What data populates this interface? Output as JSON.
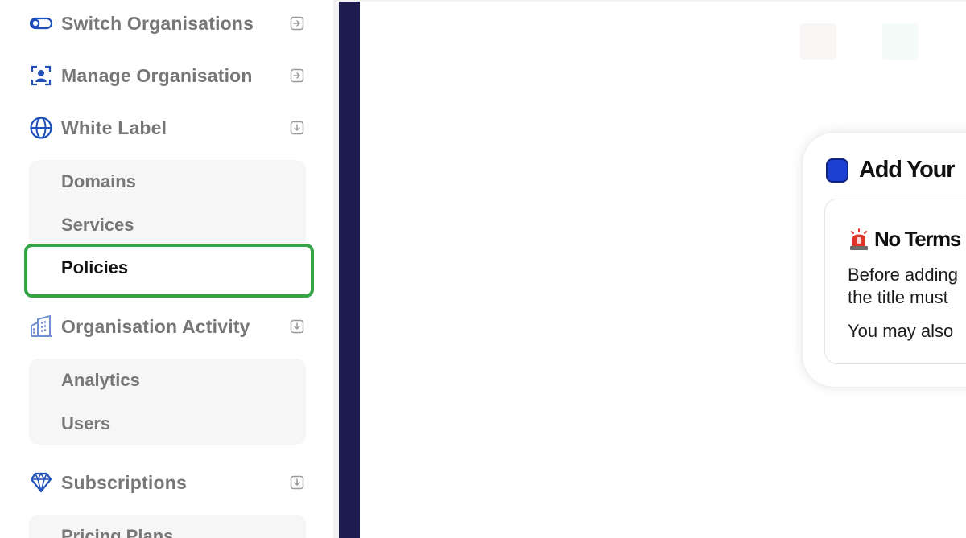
{
  "sidebar": {
    "items": [
      {
        "label": "Switch Organisations",
        "icon": "toggle-icon",
        "arrow": "arrow-right-icon"
      },
      {
        "label": "Manage Organisation",
        "icon": "user-frame-icon",
        "arrow": "arrow-right-icon"
      },
      {
        "label": "White Label",
        "icon": "globe-icon",
        "arrow": "arrow-down-icon"
      },
      {
        "label": "Organisation Activity",
        "icon": "buildings-icon",
        "arrow": "arrow-down-icon"
      },
      {
        "label": "Subscriptions",
        "icon": "diamond-icon",
        "arrow": "arrow-down-icon"
      }
    ],
    "white_label_sub": [
      "Domains",
      "Services",
      "Policies"
    ],
    "activity_sub": [
      "Analytics",
      "Users"
    ],
    "subscriptions_sub": [
      "Pricing Plans"
    ],
    "active_item": "Policies"
  },
  "main": {
    "card": {
      "title": "Add Your",
      "alert_title": "No Terms",
      "line1": "Before adding",
      "line2": "the title must",
      "line3": "You may also"
    }
  },
  "colors": {
    "accent": "#1f4fb8",
    "highlight": "#34a447",
    "dark_bar": "#1c1a4e",
    "muted_text": "#777777"
  }
}
